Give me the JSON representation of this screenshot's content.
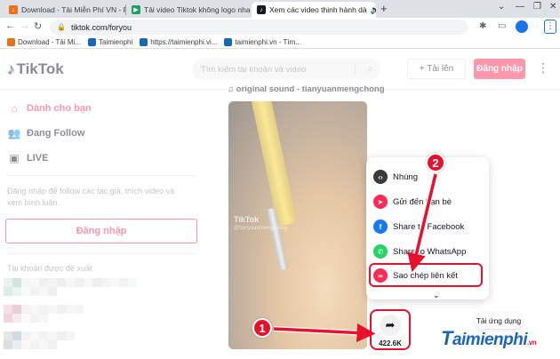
{
  "browser": {
    "tabs": [
      {
        "title": "Download - Tải Miễn Phí VN - Ph",
        "favicon_color": "#e8711c",
        "active": false
      },
      {
        "title": "Tải video Tiktok không logo nhan",
        "favicon_color": "#1aa260",
        "active": false
      },
      {
        "title": "Xem các video thịnh hành dà",
        "favicon_color": "#161823",
        "active": true
      }
    ],
    "new_tab": "+",
    "url": "tiktok.com/foryou",
    "bookmarks": [
      {
        "label": "Download - Tải Mi...",
        "color": "#e8711c"
      },
      {
        "label": "Taimienphi",
        "color": "#1a66b8"
      },
      {
        "label": "https://taimienphi.vi...",
        "color": "#1a66b8"
      },
      {
        "label": "taimienphi.vn - Tìm...",
        "color": "#1a66b8"
      }
    ]
  },
  "tiktok": {
    "logo": "TikTok",
    "search_placeholder": "Tìm kiếm tài khoản và video",
    "upload_label": "+ Tải lên",
    "login_label": "Đăng nhập",
    "nav": [
      {
        "label": "Dành cho bạn",
        "icon": "home-icon",
        "active": true
      },
      {
        "label": "Đang Follow",
        "icon": "people-icon",
        "active": false
      },
      {
        "label": "LIVE",
        "icon": "live-icon",
        "active": false
      }
    ],
    "login_prompt": "Đăng nhập để follow các tác giả, thích video và xem bình luận.",
    "sidebar_login_label": "Đăng nhập",
    "suggested_title": "Tài khoản được đề xuất",
    "sound": "♫ original sound - tianyuanmengchong",
    "video_watermark": "TikTok",
    "video_watermark_user": "@tianyuanmengchong",
    "share_menu": [
      {
        "label": "Nhúng",
        "icon": "embed-icon",
        "color": "#3a3a3a",
        "glyph": "</>"
      },
      {
        "label": "Gửi đến bạn bè",
        "icon": "send-icon",
        "color": "#fe2c55",
        "glyph": "➤"
      },
      {
        "label": "Share to Facebook",
        "icon": "facebook-icon",
        "color": "#1877f2",
        "glyph": "f"
      },
      {
        "label": "Share to WhatsApp",
        "icon": "whatsapp-icon",
        "color": "#25d366",
        "glyph": "✆"
      },
      {
        "label": "Sao chép liên kết",
        "icon": "link-icon",
        "color": "#fe2c55",
        "glyph": "🔗"
      }
    ],
    "share_count": "422.6K",
    "app_button": "Tải ứng dụng"
  },
  "annotations": {
    "step1": "1",
    "step2": "2",
    "accent": "#e8112d"
  },
  "brand": {
    "name": "aimienphi",
    "initial": "T",
    "suffix": ".vn"
  }
}
